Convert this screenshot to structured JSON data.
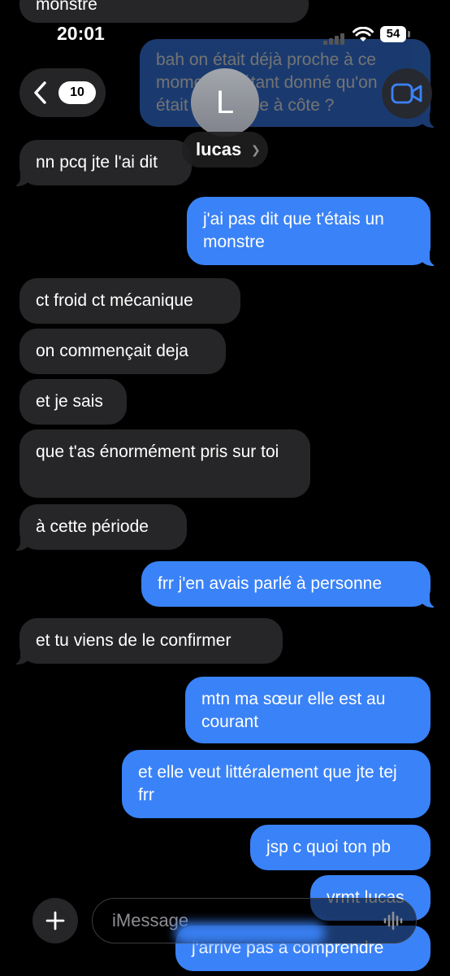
{
  "status": {
    "time": "20:01",
    "battery": "54"
  },
  "header": {
    "back_count": "10",
    "avatar_initial": "L",
    "contact_name": "lucas"
  },
  "messages": [
    {
      "dir": "in",
      "text": "monstre"
    },
    {
      "dir": "out",
      "text": "bah on était déjà proche à ce moment-là étant donné qu'on était assis côte à côte ?"
    },
    {
      "dir": "in",
      "text": "nn pcq jte l'ai dit"
    },
    {
      "dir": "out",
      "text": "j'ai pas dit que t'étais un monstre"
    },
    {
      "dir": "in",
      "text": "ct froid ct mécanique"
    },
    {
      "dir": "in",
      "text": "on commençait deja"
    },
    {
      "dir": "in",
      "text": "et je sais"
    },
    {
      "dir": "in",
      "text": "que t'as énormément pris sur toi"
    },
    {
      "dir": "in",
      "text": "à cette période"
    },
    {
      "dir": "out",
      "text": "frr j'en avais parlé à personne"
    },
    {
      "dir": "in",
      "text": "et tu viens de le confirmer"
    },
    {
      "dir": "out",
      "text": "mtn ma sœur elle est au courant"
    },
    {
      "dir": "out",
      "text": "et elle veut littéralement que jte tej frr"
    },
    {
      "dir": "out",
      "text": "jsp c quoi ton pb"
    },
    {
      "dir": "out",
      "text": "vrmt lucas"
    },
    {
      "dir": "out",
      "text": "j'arrive pas a comprendre"
    }
  ],
  "input": {
    "placeholder": "iMessage"
  },
  "icons": [
    "chevron-left-icon",
    "video-camera-icon",
    "wifi-icon",
    "signal-icon",
    "battery-icon",
    "plus-icon",
    "waveform-icon"
  ],
  "colors": {
    "outgoing": "#3a82f7",
    "incoming": "#262628",
    "background": "#000000"
  }
}
